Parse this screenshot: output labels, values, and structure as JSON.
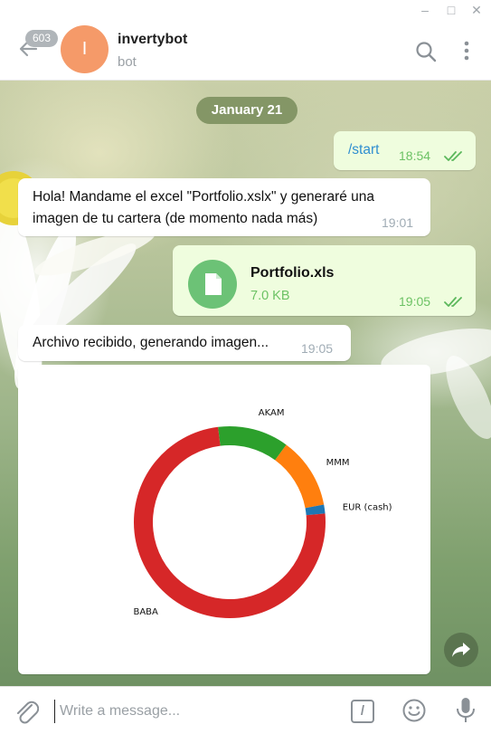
{
  "window": {
    "controls": [
      "–",
      "□",
      "✕"
    ]
  },
  "header": {
    "unread_count": "603",
    "avatar_letter": "I",
    "avatar_color": "#f59a69",
    "name": "invertybot",
    "status": "bot"
  },
  "chat": {
    "date": "January 21",
    "messages": [
      {
        "type": "outgoing",
        "text": "/start",
        "time": "18:54",
        "read": true
      },
      {
        "type": "incoming",
        "text": "Hola! Mandame el excel \"Portfolio.xslx\" y generaré una imagen de tu cartera (de momento nada más)",
        "time": "19:01"
      },
      {
        "type": "outgoing-file",
        "file_name": "Portfolio.xls",
        "file_size": "7.0 KB",
        "time": "19:05",
        "read": true
      },
      {
        "type": "incoming",
        "text": "Archivo recibido, generando imagen...",
        "time": "19:05"
      }
    ]
  },
  "chart_data": {
    "type": "pie",
    "style": "donut",
    "slices": [
      {
        "label": "BABA",
        "value": 74.5,
        "color": "#d62728"
      },
      {
        "label": "AKAM",
        "value": 12.0,
        "color": "#2ca02c"
      },
      {
        "label": "MMM",
        "value": 12.0,
        "color": "#ff7f0e"
      },
      {
        "label": "EUR (cash)",
        "value": 1.5,
        "color": "#1f77b4"
      }
    ]
  },
  "input": {
    "placeholder": "Write a message...",
    "command_label": "/"
  },
  "icons": {
    "back": "arrow-left-icon",
    "search": "search-icon",
    "menu": "more-vertical-icon",
    "attach": "paperclip-icon",
    "emoji": "smile-icon",
    "mic": "microphone-icon",
    "forward": "forward-icon",
    "file": "document-icon"
  }
}
